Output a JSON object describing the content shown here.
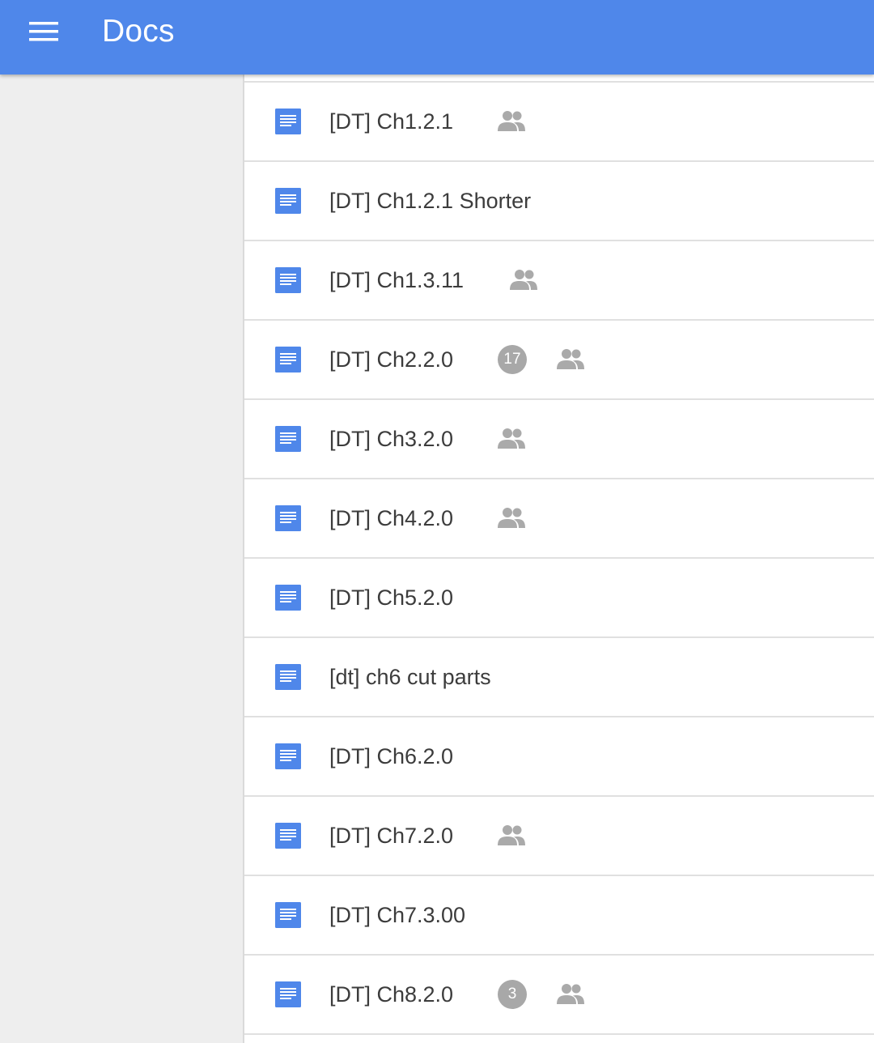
{
  "appbar": {
    "title": "Docs",
    "menu_icon": "hamburger-menu-icon",
    "color": "#4f87ea"
  },
  "colors": {
    "doc_icon": "#4f87ea",
    "badge": "#a8a8a8",
    "shared_icon": "#aaaaaa",
    "sidebar": "#eeeeee"
  },
  "documents": [
    {
      "title": "[DT] Ch1.2.1",
      "badge": null,
      "shared": true
    },
    {
      "title": "[DT] Ch1.2.1 Shorter",
      "badge": null,
      "shared": false
    },
    {
      "title": "[DT] Ch1.3.11",
      "badge": null,
      "shared": true
    },
    {
      "title": "[DT] Ch2.2.0",
      "badge": "17",
      "shared": true
    },
    {
      "title": "[DT] Ch3.2.0",
      "badge": null,
      "shared": true
    },
    {
      "title": "[DT] Ch4.2.0",
      "badge": null,
      "shared": true
    },
    {
      "title": "[DT] Ch5.2.0",
      "badge": null,
      "shared": false
    },
    {
      "title": "[dt] ch6 cut parts",
      "badge": null,
      "shared": false
    },
    {
      "title": "[DT] Ch6.2.0",
      "badge": null,
      "shared": false
    },
    {
      "title": "[DT] Ch7.2.0",
      "badge": null,
      "shared": true
    },
    {
      "title": "[DT] Ch7.3.00",
      "badge": null,
      "shared": false
    },
    {
      "title": "[DT] Ch8.2.0",
      "badge": "3",
      "shared": true
    }
  ]
}
